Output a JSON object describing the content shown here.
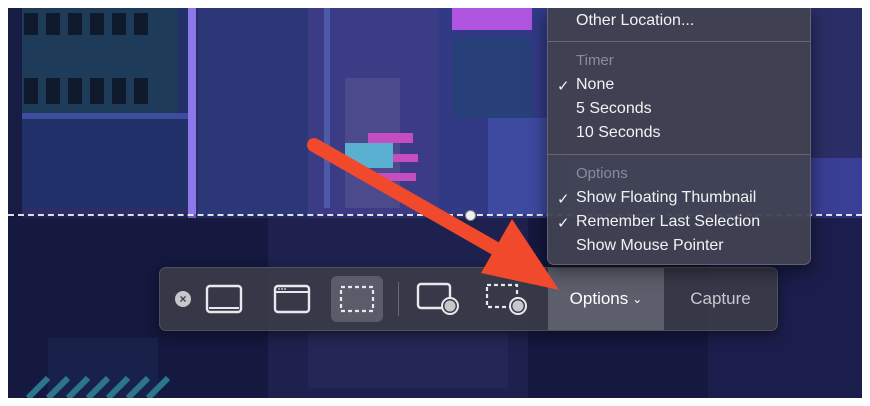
{
  "toolbar": {
    "options_label": "Options",
    "capture_label": "Capture"
  },
  "menu": {
    "save_items": [
      "Other Location..."
    ],
    "timer_header": "Timer",
    "timer_items": [
      {
        "label": "None",
        "checked": true
      },
      {
        "label": "5 Seconds",
        "checked": false
      },
      {
        "label": "10 Seconds",
        "checked": false
      }
    ],
    "options_header": "Options",
    "options_items": [
      {
        "label": "Show Floating Thumbnail",
        "checked": true
      },
      {
        "label": "Remember Last Selection",
        "checked": true
      },
      {
        "label": "Show Mouse Pointer",
        "checked": false
      }
    ],
    "check_glyph": "✓"
  },
  "icons": {
    "close": "close-icon",
    "capture_entire_screen": "screen-icon",
    "capture_window": "window-icon",
    "capture_selection": "dashed-selection-icon",
    "record_screen": "record-screen-icon",
    "record_selection": "record-selection-icon",
    "annotation": "red-arrow"
  },
  "colors": {
    "arrow": "#f0492b",
    "menu_bg": "#404252",
    "toolbar_bg": "#3a3c48",
    "options_active": "#5c5e6c"
  }
}
